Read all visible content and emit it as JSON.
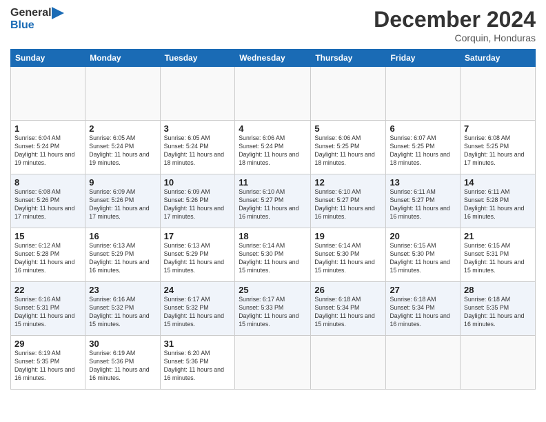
{
  "header": {
    "logo_line1": "General",
    "logo_line2": "Blue",
    "main_title": "December 2024",
    "subtitle": "Corquin, Honduras"
  },
  "calendar": {
    "days_of_week": [
      "Sunday",
      "Monday",
      "Tuesday",
      "Wednesday",
      "Thursday",
      "Friday",
      "Saturday"
    ],
    "weeks": [
      [
        {
          "day": "",
          "info": ""
        },
        {
          "day": "",
          "info": ""
        },
        {
          "day": "",
          "info": ""
        },
        {
          "day": "",
          "info": ""
        },
        {
          "day": "",
          "info": ""
        },
        {
          "day": "",
          "info": ""
        },
        {
          "day": "",
          "info": ""
        }
      ],
      [
        {
          "day": "1",
          "info": "Sunrise: 6:04 AM\nSunset: 5:24 PM\nDaylight: 11 hours\nand 19 minutes."
        },
        {
          "day": "2",
          "info": "Sunrise: 6:05 AM\nSunset: 5:24 PM\nDaylight: 11 hours\nand 19 minutes."
        },
        {
          "day": "3",
          "info": "Sunrise: 6:05 AM\nSunset: 5:24 PM\nDaylight: 11 hours\nand 18 minutes."
        },
        {
          "day": "4",
          "info": "Sunrise: 6:06 AM\nSunset: 5:24 PM\nDaylight: 11 hours\nand 18 minutes."
        },
        {
          "day": "5",
          "info": "Sunrise: 6:06 AM\nSunset: 5:25 PM\nDaylight: 11 hours\nand 18 minutes."
        },
        {
          "day": "6",
          "info": "Sunrise: 6:07 AM\nSunset: 5:25 PM\nDaylight: 11 hours\nand 18 minutes."
        },
        {
          "day": "7",
          "info": "Sunrise: 6:08 AM\nSunset: 5:25 PM\nDaylight: 11 hours\nand 17 minutes."
        }
      ],
      [
        {
          "day": "8",
          "info": "Sunrise: 6:08 AM\nSunset: 5:26 PM\nDaylight: 11 hours\nand 17 minutes."
        },
        {
          "day": "9",
          "info": "Sunrise: 6:09 AM\nSunset: 5:26 PM\nDaylight: 11 hours\nand 17 minutes."
        },
        {
          "day": "10",
          "info": "Sunrise: 6:09 AM\nSunset: 5:26 PM\nDaylight: 11 hours\nand 17 minutes."
        },
        {
          "day": "11",
          "info": "Sunrise: 6:10 AM\nSunset: 5:27 PM\nDaylight: 11 hours\nand 16 minutes."
        },
        {
          "day": "12",
          "info": "Sunrise: 6:10 AM\nSunset: 5:27 PM\nDaylight: 11 hours\nand 16 minutes."
        },
        {
          "day": "13",
          "info": "Sunrise: 6:11 AM\nSunset: 5:27 PM\nDaylight: 11 hours\nand 16 minutes."
        },
        {
          "day": "14",
          "info": "Sunrise: 6:11 AM\nSunset: 5:28 PM\nDaylight: 11 hours\nand 16 minutes."
        }
      ],
      [
        {
          "day": "15",
          "info": "Sunrise: 6:12 AM\nSunset: 5:28 PM\nDaylight: 11 hours\nand 16 minutes."
        },
        {
          "day": "16",
          "info": "Sunrise: 6:13 AM\nSunset: 5:29 PM\nDaylight: 11 hours\nand 16 minutes."
        },
        {
          "day": "17",
          "info": "Sunrise: 6:13 AM\nSunset: 5:29 PM\nDaylight: 11 hours\nand 15 minutes."
        },
        {
          "day": "18",
          "info": "Sunrise: 6:14 AM\nSunset: 5:30 PM\nDaylight: 11 hours\nand 15 minutes."
        },
        {
          "day": "19",
          "info": "Sunrise: 6:14 AM\nSunset: 5:30 PM\nDaylight: 11 hours\nand 15 minutes."
        },
        {
          "day": "20",
          "info": "Sunrise: 6:15 AM\nSunset: 5:30 PM\nDaylight: 11 hours\nand 15 minutes."
        },
        {
          "day": "21",
          "info": "Sunrise: 6:15 AM\nSunset: 5:31 PM\nDaylight: 11 hours\nand 15 minutes."
        }
      ],
      [
        {
          "day": "22",
          "info": "Sunrise: 6:16 AM\nSunset: 5:31 PM\nDaylight: 11 hours\nand 15 minutes."
        },
        {
          "day": "23",
          "info": "Sunrise: 6:16 AM\nSunset: 5:32 PM\nDaylight: 11 hours\nand 15 minutes."
        },
        {
          "day": "24",
          "info": "Sunrise: 6:17 AM\nSunset: 5:32 PM\nDaylight: 11 hours\nand 15 minutes."
        },
        {
          "day": "25",
          "info": "Sunrise: 6:17 AM\nSunset: 5:33 PM\nDaylight: 11 hours\nand 15 minutes."
        },
        {
          "day": "26",
          "info": "Sunrise: 6:18 AM\nSunset: 5:34 PM\nDaylight: 11 hours\nand 15 minutes."
        },
        {
          "day": "27",
          "info": "Sunrise: 6:18 AM\nSunset: 5:34 PM\nDaylight: 11 hours\nand 16 minutes."
        },
        {
          "day": "28",
          "info": "Sunrise: 6:18 AM\nSunset: 5:35 PM\nDaylight: 11 hours\nand 16 minutes."
        }
      ],
      [
        {
          "day": "29",
          "info": "Sunrise: 6:19 AM\nSunset: 5:35 PM\nDaylight: 11 hours\nand 16 minutes."
        },
        {
          "day": "30",
          "info": "Sunrise: 6:19 AM\nSunset: 5:36 PM\nDaylight: 11 hours\nand 16 minutes."
        },
        {
          "day": "31",
          "info": "Sunrise: 6:20 AM\nSunset: 5:36 PM\nDaylight: 11 hours\nand 16 minutes."
        },
        {
          "day": "",
          "info": ""
        },
        {
          "day": "",
          "info": ""
        },
        {
          "day": "",
          "info": ""
        },
        {
          "day": "",
          "info": ""
        }
      ]
    ]
  }
}
